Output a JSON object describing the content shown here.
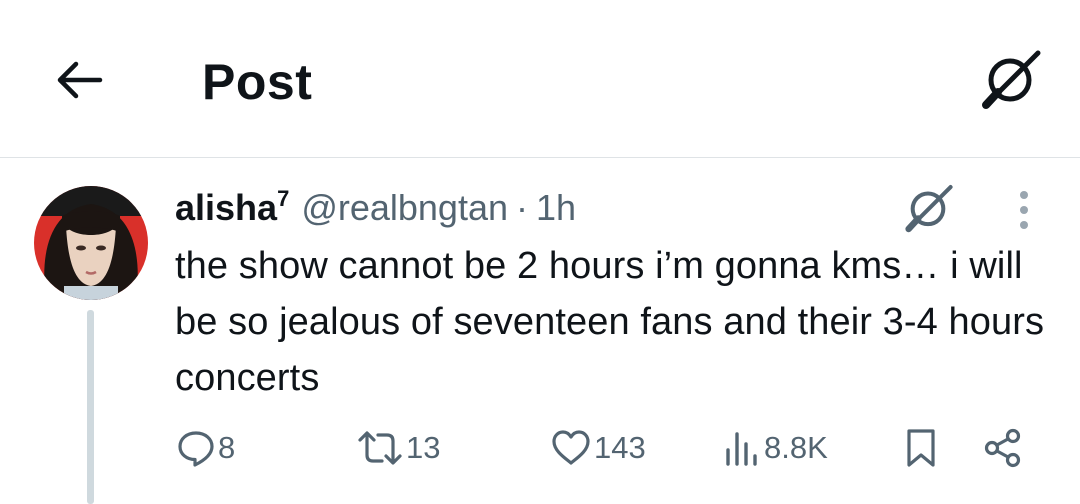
{
  "header": {
    "title": "Post",
    "back_icon": "arrow-left-icon",
    "grok_icon": "grok-icon"
  },
  "tweet": {
    "display_name": "alisha",
    "name_suffix": "7",
    "handle": "@realbngtan",
    "separator": "·",
    "time": "1h",
    "text": "the show cannot be 2 hours i’m gonna kms… i will be so jealous of seventeen fans and their 3-4 hours concerts",
    "avatar_colors": {
      "background": "#d9302a",
      "hair": "#1c1512",
      "skin": "#ead2c0"
    }
  },
  "actions": {
    "replies": "8",
    "reposts": "13",
    "likes": "143",
    "views": "8.8K"
  },
  "colors": {
    "text_primary": "#0f1419",
    "text_secondary": "#536471",
    "divider": "#dfe3e6",
    "thread_line": "#cfd9de"
  }
}
